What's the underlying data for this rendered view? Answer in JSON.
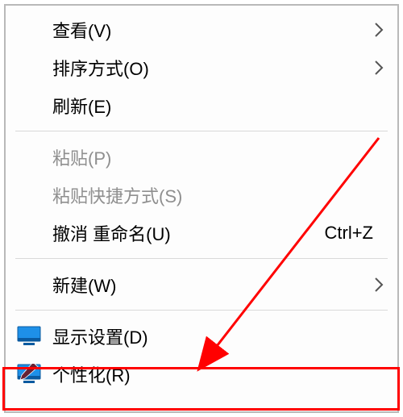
{
  "menu": {
    "items": [
      {
        "id": "view",
        "label": "查看(V)",
        "hasSubmenu": true,
        "disabled": false
      },
      {
        "id": "sort",
        "label": "排序方式(O)",
        "hasSubmenu": true,
        "disabled": false
      },
      {
        "id": "refresh",
        "label": "刷新(E)",
        "hasSubmenu": false,
        "disabled": false
      },
      {
        "id": "paste",
        "label": "粘贴(P)",
        "hasSubmenu": false,
        "disabled": true
      },
      {
        "id": "paste-shortcut",
        "label": "粘贴快捷方式(S)",
        "hasSubmenu": false,
        "disabled": true
      },
      {
        "id": "undo-rename",
        "label": "撤消 重命名(U)",
        "hasSubmenu": false,
        "disabled": false,
        "shortcut": "Ctrl+Z"
      },
      {
        "id": "new",
        "label": "新建(W)",
        "hasSubmenu": true,
        "disabled": false
      },
      {
        "id": "display-settings",
        "label": "显示设置(D)",
        "hasSubmenu": false,
        "disabled": false,
        "icon": "monitor"
      },
      {
        "id": "personalize",
        "label": "个性化(R)",
        "hasSubmenu": false,
        "disabled": false,
        "icon": "personalize"
      }
    ]
  },
  "highlight_target": "personalize",
  "colors": {
    "highlight": "#ff0000",
    "disabled_text": "#8f8f8f",
    "border": "#b9b9b9"
  }
}
